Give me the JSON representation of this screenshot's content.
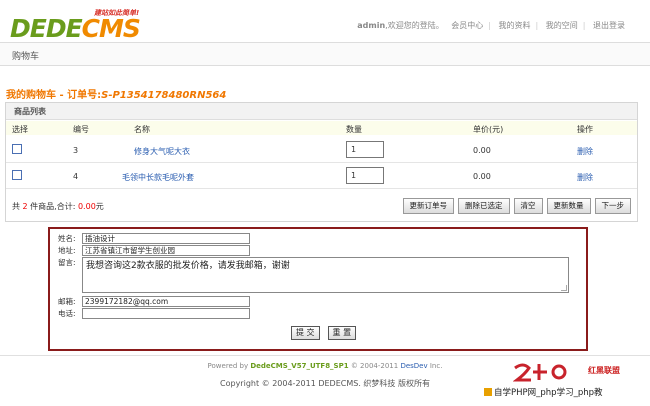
{
  "header": {
    "logo_main": "DEDE",
    "logo_cms": "CMS",
    "logo_slogan": "建站如此简单!",
    "user": "admin",
    "welcome": ",欢迎您的登陆。",
    "nav": [
      "会员中心",
      "我的资料",
      "我的空间",
      "退出登录"
    ]
  },
  "breadcrumb": "购物车",
  "cart": {
    "title": "我的购物车 - 订单号:",
    "order_no": "S-P1354178480RN564",
    "list_title": "商品列表",
    "columns": [
      "选择",
      "编号",
      "名称",
      "数量",
      "单价(元)",
      "操作"
    ],
    "rows": [
      {
        "id": "3",
        "name": "修身大气呢大衣",
        "qty": "1",
        "price": "0.00",
        "action": "删除"
      },
      {
        "id": "4",
        "name": "毛领中长款毛呢外套",
        "qty": "1",
        "price": "0.00",
        "action": "删除"
      }
    ],
    "summary_prefix": "共 ",
    "count": "2",
    "summary_mid": " 件商品,合计: ",
    "total": "0.00",
    "summary_suffix": "元",
    "buttons": [
      "更新订单号",
      "删除已选定",
      "清空",
      "更新数量",
      "下一步"
    ]
  },
  "form": {
    "name_label": "姓名:",
    "name_value": "插油设计",
    "address_label": "地址:",
    "address_value": "江苏省镇江市留学生创业园",
    "message_label": "留言:",
    "message_value": "我想咨询这2款衣服的批发价格，请发我邮箱，谢谢",
    "email_label": "邮箱:",
    "email_value": "2399172182@qq.com",
    "phone_label": "电话:",
    "phone_value": "",
    "submit": "提 交",
    "reset": "重 置"
  },
  "footer": {
    "powered_prefix": "Powered by ",
    "powered_product": "DedeCMS_V57_UTF8_SP1",
    "powered_mid": " © 2004-2011 ",
    "powered_company": "DesDev",
    "powered_suffix": " Inc.",
    "copyright": "Copyright © 2004-2011 DEDECMS. 织梦科技 版权所有"
  },
  "watermark": {
    "brand": "红黑联盟",
    "text": "自学PHP网_php学习_php教"
  },
  "colors": {
    "accent_orange": "#f07700",
    "logo_green": "#6a9c1c",
    "link_blue": "#2a5db0",
    "form_border": "#8a1b1b"
  }
}
